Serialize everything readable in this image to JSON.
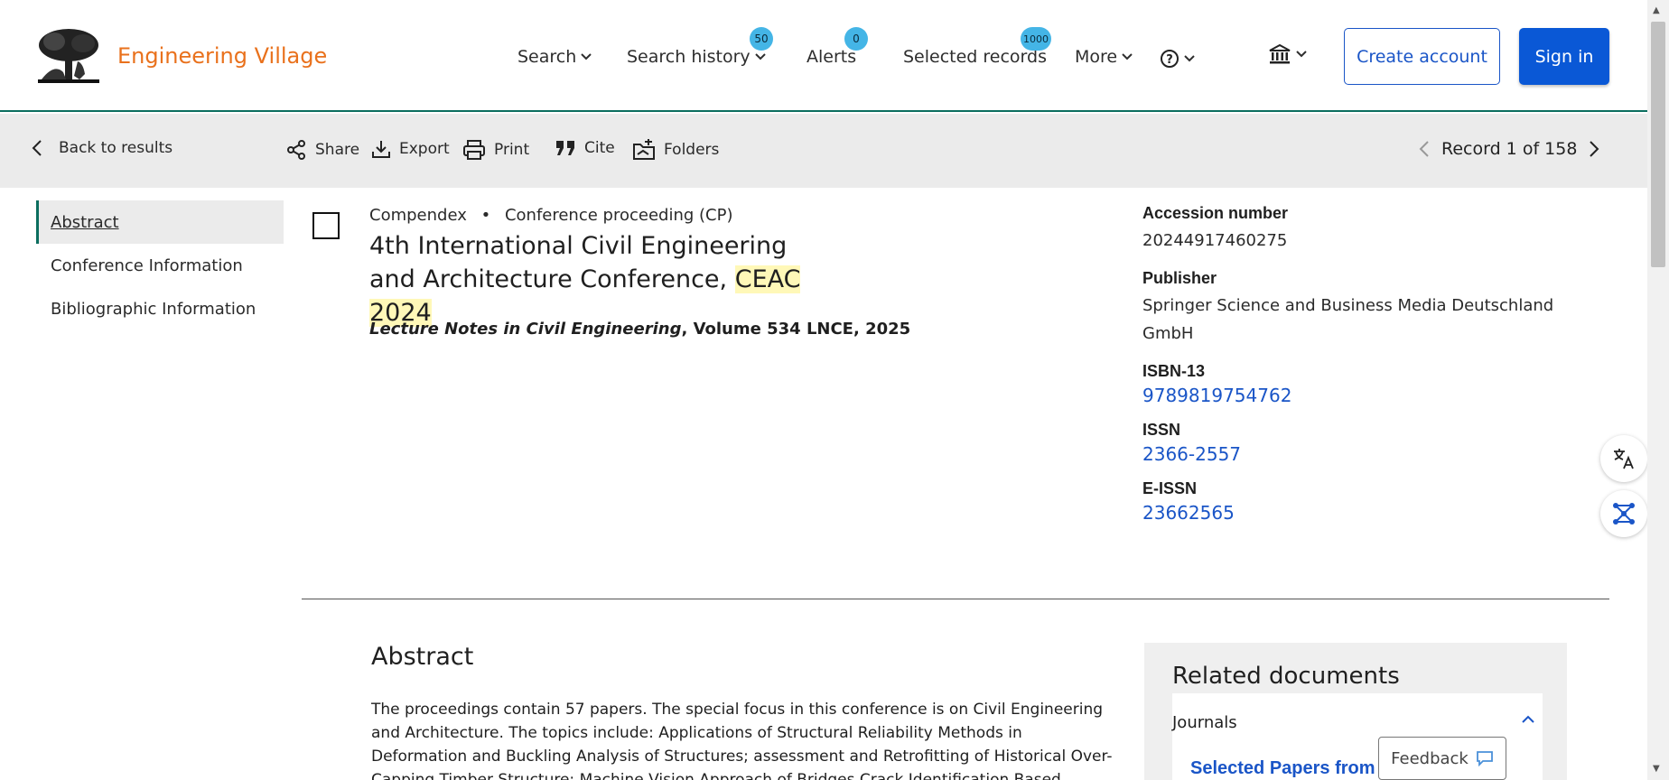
{
  "header": {
    "brand": "Engineering Village",
    "nav": {
      "search": "Search",
      "search_history": "Search history",
      "search_history_badge": "50",
      "alerts": "Alerts",
      "alerts_badge": "0",
      "selected_records": "Selected records",
      "selected_records_badge": "1000",
      "more": "More",
      "help": "?"
    },
    "create_account": "Create account",
    "sign_in": "Sign in"
  },
  "toolbar": {
    "back": "Back to results",
    "share": "Share",
    "export": "Export",
    "print": "Print",
    "cite": "Cite",
    "folders": "Folders",
    "record_position": "Record 1 of 158"
  },
  "sidenav": {
    "items": [
      "Abstract",
      "Conference Information",
      "Bibliographic Information"
    ]
  },
  "record": {
    "database": "Compendex",
    "doc_type": "Conference proceeding (CP)",
    "title_part1": "4th International Civil Engineering and Architecture Conference, ",
    "title_hl1": "CEAC",
    "title_hl2": "2024",
    "source_series": "Lecture Notes in Civil Engineering",
    "source_rest": ", Volume 534 LNCE, 2025"
  },
  "metadata": {
    "accession_label": "Accession number",
    "accession_value": "20244917460275",
    "publisher_label": "Publisher",
    "publisher_value": "Springer Science and Business Media Deutschland GmbH",
    "isbn_label": "ISBN-13",
    "isbn_value": "9789819754762",
    "issn_label": "ISSN",
    "issn_value": "2366-2557",
    "eissn_label": "E-ISSN",
    "eissn_value": "23662565"
  },
  "abstract": {
    "heading": "Abstract",
    "body": "The proceedings contain 57 papers. The special focus in this conference is on Civil Engineering and Architecture. The topics include: Applications of Structural Reliability Methods in Deformation and Buckling Analysis of Structures; assessment and Retrofitting of Historical Over-Capping Timber Structure; Machine Vision Approach of Bridges Crack Identification Based"
  },
  "related": {
    "heading": "Related documents",
    "journals": "Journals",
    "selected_papers": "Selected Papers from"
  },
  "feedback": "Feedback",
  "colors": {
    "brand_orange": "#e9711c",
    "primary_blue": "#0a58d6",
    "link_blue": "#1a55c7",
    "accent_teal": "#0b6e5f",
    "badge_blue": "#44b5e6",
    "highlight_yellow": "#fff8b8"
  }
}
